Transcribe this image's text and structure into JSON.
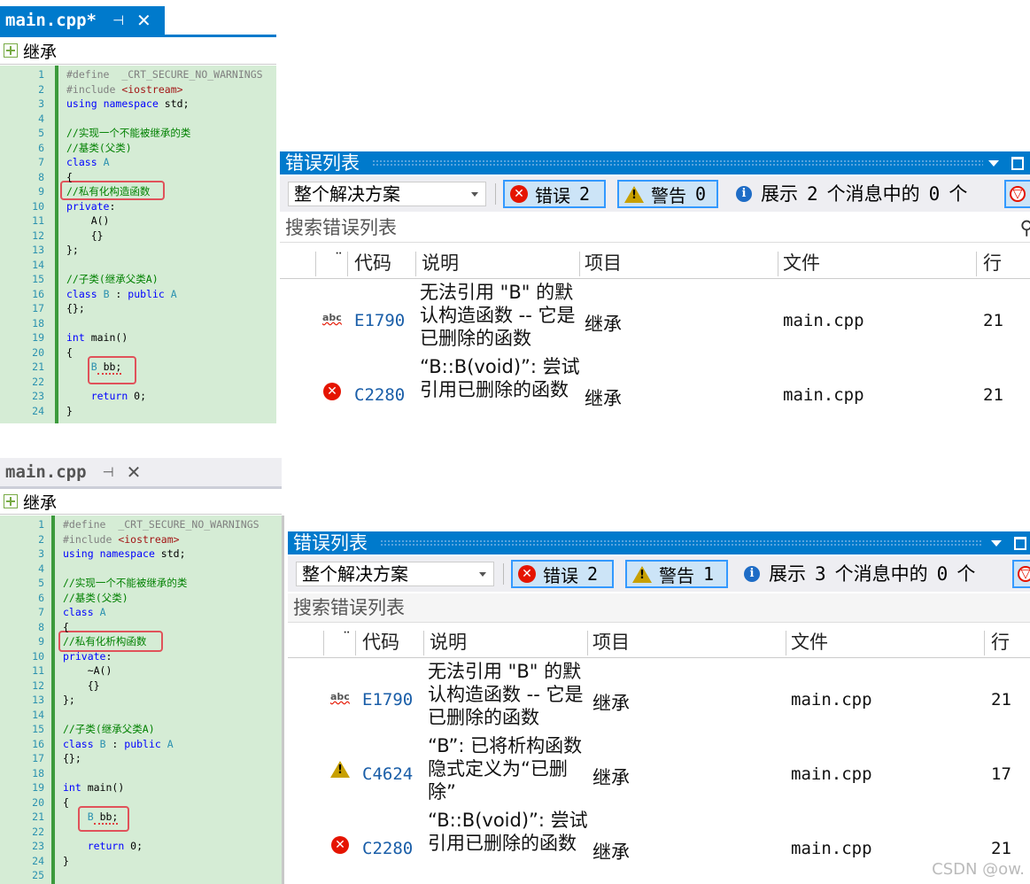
{
  "top": {
    "tab": {
      "name": "main.cpp*",
      "pin": "⊣",
      "close": "✕"
    },
    "nav": "继承",
    "code": [
      {
        "n": "1",
        "parts": [
          [
            "pre",
            "#define  "
          ],
          [
            "pre",
            "_CRT_SECURE_NO_WARNINGS"
          ]
        ]
      },
      {
        "n": "2",
        "parts": [
          [
            "pre",
            "#include "
          ],
          [
            "str",
            "<iostream>"
          ]
        ]
      },
      {
        "n": "3",
        "parts": [
          [
            "kw",
            "using"
          ],
          [
            "tx",
            " "
          ],
          [
            "kw",
            "namespace"
          ],
          [
            "tx",
            " std;"
          ]
        ]
      },
      {
        "n": "4",
        "parts": []
      },
      {
        "n": "5",
        "parts": [
          [
            "cm",
            "//实现一个不能被继承的类"
          ]
        ]
      },
      {
        "n": "6",
        "parts": [
          [
            "cm",
            "//基类(父类)"
          ]
        ]
      },
      {
        "n": "7",
        "parts": [
          [
            "kw",
            "class"
          ],
          [
            "tx",
            " "
          ],
          [
            "tp",
            "A"
          ]
        ]
      },
      {
        "n": "8",
        "parts": [
          [
            "tx",
            "{"
          ]
        ]
      },
      {
        "n": "9",
        "parts": [
          [
            "cm",
            "//私有化构造函数"
          ]
        ]
      },
      {
        "n": "10",
        "parts": [
          [
            "kw",
            "private"
          ],
          [
            "tx",
            ":"
          ]
        ]
      },
      {
        "n": "11",
        "parts": [
          [
            "tx",
            "    A()"
          ]
        ]
      },
      {
        "n": "12",
        "parts": [
          [
            "tx",
            "    {}"
          ]
        ]
      },
      {
        "n": "13",
        "parts": [
          [
            "tx",
            "};"
          ]
        ]
      },
      {
        "n": "14",
        "parts": []
      },
      {
        "n": "15",
        "parts": [
          [
            "cm",
            "//子类(继承父类A)"
          ]
        ]
      },
      {
        "n": "16",
        "parts": [
          [
            "kw",
            "class"
          ],
          [
            "tx",
            " "
          ],
          [
            "tp",
            "B"
          ],
          [
            "tx",
            " : "
          ],
          [
            "kw",
            "public"
          ],
          [
            "tx",
            " "
          ],
          [
            "tp",
            "A"
          ]
        ]
      },
      {
        "n": "17",
        "parts": [
          [
            "tx",
            "{};"
          ]
        ]
      },
      {
        "n": "18",
        "parts": []
      },
      {
        "n": "19",
        "parts": [
          [
            "kw",
            "int"
          ],
          [
            "tx",
            " main()"
          ]
        ]
      },
      {
        "n": "20",
        "parts": [
          [
            "tx",
            "{"
          ]
        ]
      },
      {
        "n": "21",
        "parts": [
          [
            "tx",
            "    "
          ],
          [
            "tp",
            "B"
          ],
          [
            "tx",
            " bb;"
          ]
        ]
      },
      {
        "n": "22",
        "parts": []
      },
      {
        "n": "23",
        "parts": [
          [
            "tx",
            "    "
          ],
          [
            "kw",
            "return"
          ],
          [
            "tx",
            " 0;"
          ]
        ]
      },
      {
        "n": "24",
        "parts": [
          [
            "tx",
            "}"
          ]
        ]
      }
    ],
    "errors": {
      "title": "错误列表",
      "scope": "整个解决方案",
      "err_label": "错误",
      "err_count": "2",
      "warn_label": "警告",
      "warn_count": "0",
      "msg_a": "展示",
      "msg_n1": "2",
      "msg_b": "个消息中的",
      "msg_n2": "0",
      "msg_c": "个",
      "search": "搜索错误列表",
      "cols": {
        "code": "代码",
        "desc": "说明",
        "proj": "项目",
        "file": "文件",
        "line": "行"
      },
      "rows": [
        {
          "icon": "abc",
          "code": "E1790",
          "desc": "无法引用 \"B\" 的默认构造函数 -- 它是已删除的函数",
          "proj": "继承",
          "file": "main.cpp",
          "line": "21"
        },
        {
          "icon": "error",
          "code": "C2280",
          "desc": "“B::B(void)”: 尝试引用已删除的函数",
          "proj": "继承",
          "file": "main.cpp",
          "line": "21"
        }
      ]
    }
  },
  "bottom": {
    "tab": {
      "name": "main.cpp",
      "pin": "⊣",
      "close": "✕"
    },
    "nav": "继承",
    "code": [
      {
        "n": "1",
        "parts": [
          [
            "pre",
            "#define  "
          ],
          [
            "pre",
            "_CRT_SECURE_NO_WARNINGS"
          ]
        ]
      },
      {
        "n": "2",
        "parts": [
          [
            "pre",
            "#include "
          ],
          [
            "str",
            "<iostream>"
          ]
        ]
      },
      {
        "n": "3",
        "parts": [
          [
            "kw",
            "using"
          ],
          [
            "tx",
            " "
          ],
          [
            "kw",
            "namespace"
          ],
          [
            "tx",
            " std;"
          ]
        ]
      },
      {
        "n": "4",
        "parts": []
      },
      {
        "n": "5",
        "parts": [
          [
            "cm",
            "//实现一个不能被继承的类"
          ]
        ]
      },
      {
        "n": "6",
        "parts": [
          [
            "cm",
            "//基类(父类)"
          ]
        ]
      },
      {
        "n": "7",
        "parts": [
          [
            "kw",
            "class"
          ],
          [
            "tx",
            " "
          ],
          [
            "tp",
            "A"
          ]
        ]
      },
      {
        "n": "8",
        "parts": [
          [
            "tx",
            "{"
          ]
        ]
      },
      {
        "n": "9",
        "parts": [
          [
            "cm",
            "//私有化析构函数"
          ]
        ]
      },
      {
        "n": "10",
        "parts": [
          [
            "kw",
            "private"
          ],
          [
            "tx",
            ":"
          ]
        ]
      },
      {
        "n": "11",
        "parts": [
          [
            "tx",
            "    ~A()"
          ]
        ]
      },
      {
        "n": "12",
        "parts": [
          [
            "tx",
            "    {}"
          ]
        ]
      },
      {
        "n": "13",
        "parts": [
          [
            "tx",
            "};"
          ]
        ]
      },
      {
        "n": "14",
        "parts": []
      },
      {
        "n": "15",
        "parts": [
          [
            "cm",
            "//子类(继承父类A)"
          ]
        ]
      },
      {
        "n": "16",
        "parts": [
          [
            "kw",
            "class"
          ],
          [
            "tx",
            " "
          ],
          [
            "tp",
            "B"
          ],
          [
            "tx",
            " : "
          ],
          [
            "kw",
            "public"
          ],
          [
            "tx",
            " "
          ],
          [
            "tp",
            "A"
          ]
        ]
      },
      {
        "n": "17",
        "parts": [
          [
            "tx",
            "{};"
          ]
        ]
      },
      {
        "n": "18",
        "parts": []
      },
      {
        "n": "19",
        "parts": [
          [
            "kw",
            "int"
          ],
          [
            "tx",
            " main()"
          ]
        ]
      },
      {
        "n": "20",
        "parts": [
          [
            "tx",
            "{"
          ]
        ]
      },
      {
        "n": "21",
        "parts": [
          [
            "tx",
            "    "
          ],
          [
            "tp",
            "B"
          ],
          [
            "tx",
            " bb;"
          ]
        ]
      },
      {
        "n": "22",
        "parts": []
      },
      {
        "n": "23",
        "parts": [
          [
            "tx",
            "    "
          ],
          [
            "kw",
            "return"
          ],
          [
            "tx",
            " 0;"
          ]
        ]
      },
      {
        "n": "24",
        "parts": [
          [
            "tx",
            "}"
          ]
        ]
      },
      {
        "n": "25",
        "parts": []
      }
    ],
    "errors": {
      "title": "错误列表",
      "scope": "整个解决方案",
      "err_label": "错误",
      "err_count": "2",
      "warn_label": "警告",
      "warn_count": "1",
      "msg_a": "展示",
      "msg_n1": "3",
      "msg_b": "个消息中的",
      "msg_n2": "0",
      "msg_c": "个",
      "search": "搜索错误列表",
      "cols": {
        "code": "代码",
        "desc": "说明",
        "proj": "项目",
        "file": "文件",
        "line": "行"
      },
      "rows": [
        {
          "icon": "abc",
          "code": "E1790",
          "desc": "无法引用 \"B\" 的默认构造函数 -- 它是已删除的函数",
          "proj": "继承",
          "file": "main.cpp",
          "line": "21"
        },
        {
          "icon": "warning",
          "code": "C4624",
          "desc": "“B”: 已将析构函数隐式定义为“已删除”",
          "proj": "继承",
          "file": "main.cpp",
          "line": "17"
        },
        {
          "icon": "error",
          "code": "C2280",
          "desc": "“B::B(void)”: 尝试引用已删除的函数",
          "proj": "继承",
          "file": "main.cpp",
          "line": "21"
        }
      ]
    }
  },
  "watermark": "CSDN @ow.",
  "colors": {
    "accent": "#007acc",
    "editor_bg": "#d5ecd5",
    "highlight": "#e0525a",
    "error": "#e51400",
    "warning": "#c8a000"
  }
}
